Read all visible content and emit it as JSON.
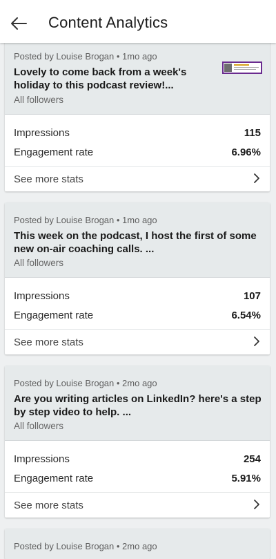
{
  "header": {
    "title": "Content Analytics",
    "back_icon": "arrow-left-icon"
  },
  "posts": [
    {
      "meta": "Posted by Louise Brogan • 1mo ago",
      "title": "Lovely to come back from a week's holiday to this podcast review!...",
      "audience": "All followers",
      "has_thumbnail": true,
      "impressions_label": "Impressions",
      "impressions": "115",
      "engagement_label": "Engagement rate",
      "engagement": "6.96%",
      "see_more": "See more stats"
    },
    {
      "meta": "Posted by Louise Brogan • 1mo ago",
      "title": "This week on the podcast, I host the first of some new on-air coaching calls. ...",
      "audience": "All followers",
      "has_thumbnail": false,
      "impressions_label": "Impressions",
      "impressions": "107",
      "engagement_label": "Engagement rate",
      "engagement": "6.54%",
      "see_more": "See more stats"
    },
    {
      "meta": "Posted by Louise Brogan • 2mo ago",
      "title": "Are you writing articles on LinkedIn? here's a step by step video to help. ...",
      "audience": "All followers",
      "has_thumbnail": false,
      "impressions_label": "Impressions",
      "impressions": "254",
      "engagement_label": "Engagement rate",
      "engagement": "5.91%",
      "see_more": "See more stats"
    },
    {
      "meta": "Posted by Louise Brogan • 2mo ago"
    }
  ]
}
